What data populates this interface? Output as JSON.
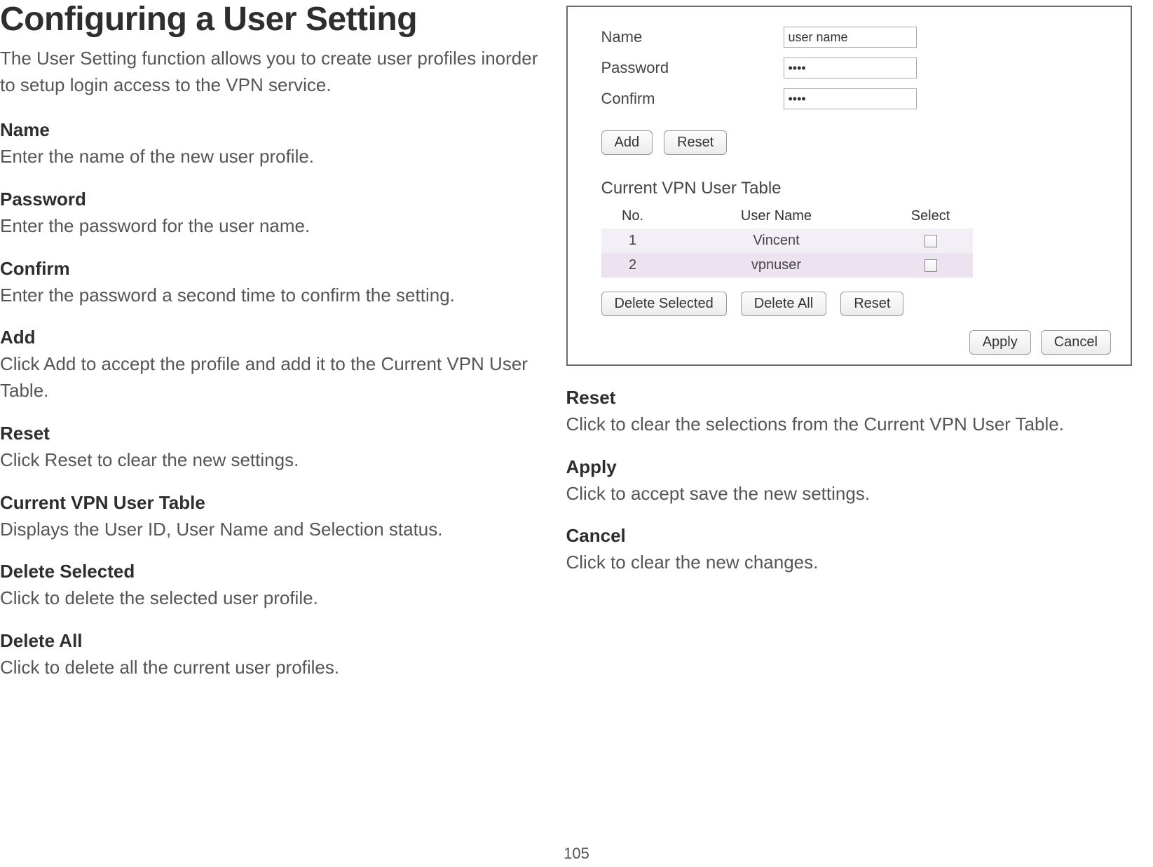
{
  "page": {
    "title": "Configuring a User Setting",
    "intro": "The User Setting function allows you to create user profiles inorder to setup login access to the VPN service.",
    "page_number": "105"
  },
  "left_items": [
    {
      "label": "Name",
      "desc": "Enter the name of the new user profile."
    },
    {
      "label": "Password",
      "desc": "Enter the password for the user name."
    },
    {
      "label": "Confirm",
      "desc": "Enter the password a second time to confirm the setting."
    },
    {
      "label": "Add",
      "desc": "Click Add to accept the profile and add it to the Current VPN User Table."
    },
    {
      "label": "Reset",
      "desc": "Click Reset to clear the new settings."
    },
    {
      "label": "Current VPN User Table",
      "desc": "Displays the User ID, User Name and Selection status."
    },
    {
      "label": "Delete Selected",
      "desc": "Click to delete the selected user profile."
    },
    {
      "label": "Delete All",
      "desc": "Click to delete all the current user profiles."
    }
  ],
  "right_items": [
    {
      "label": "Reset",
      "desc": "Click to clear the selections from the Current VPN User Table."
    },
    {
      "label": "Apply",
      "desc": "Click to accept save the new settings."
    },
    {
      "label": "Cancel",
      "desc": "Click to clear the new changes."
    }
  ],
  "panel": {
    "form": {
      "name_label": "Name",
      "name_value": "user name",
      "password_label": "Password",
      "password_value": "••••",
      "confirm_label": "Confirm",
      "confirm_value": "••••"
    },
    "buttons": {
      "add": "Add",
      "reset": "Reset",
      "delete_selected": "Delete Selected",
      "delete_all": "Delete All",
      "reset2": "Reset",
      "apply": "Apply",
      "cancel": "Cancel"
    },
    "table": {
      "title": "Current VPN User Table",
      "headers": {
        "no": "No.",
        "user_name": "User Name",
        "select": "Select"
      },
      "rows": [
        {
          "no": "1",
          "user_name": "Vincent"
        },
        {
          "no": "2",
          "user_name": "vpnuser"
        }
      ]
    }
  }
}
